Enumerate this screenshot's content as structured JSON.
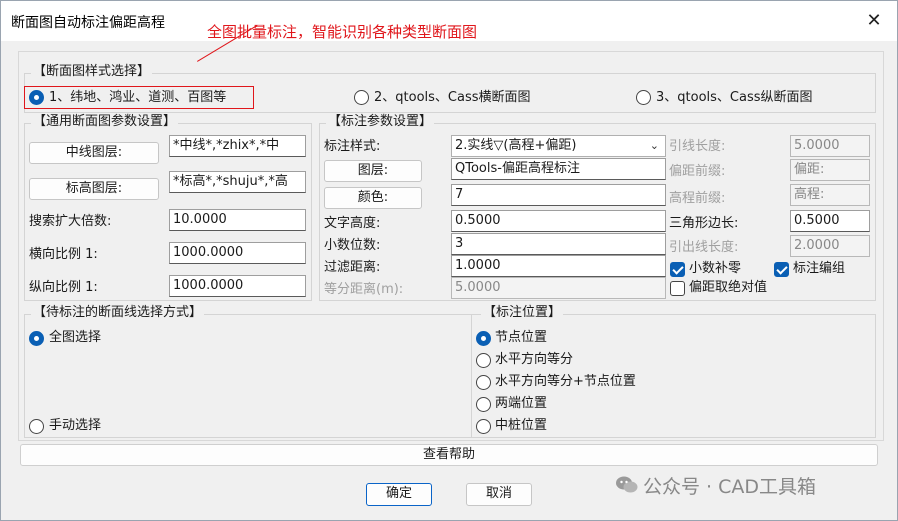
{
  "window": {
    "title": "断面图自动标注偏距高程",
    "close_glyph": "✕"
  },
  "annotation": {
    "text": "全图批量标注，智能识别各种类型断面图",
    "color": "#e0161b"
  },
  "style_group": {
    "legend": "【断面图样式选择】",
    "options": [
      {
        "label": "1、纬地、鸿业、道测、百图等",
        "selected": true
      },
      {
        "label": "2、qtools、Cass横断面图",
        "selected": false
      },
      {
        "label": "3、qtools、Cass纵断面图",
        "selected": false
      }
    ]
  },
  "general_group": {
    "legend": "【通用断面图参数设置】",
    "centerline_button": "中线图层:",
    "centerline_value": "*中线*,*zhix*,*中",
    "elev_button": "标高图层:",
    "elev_value": "*标高*,*shuju*,*高",
    "search_label": "搜索扩大倍数:",
    "search_value": "10.0000",
    "hscale_label": "横向比例 1:",
    "hscale_value": "1000.0000",
    "vscale_label": "纵向比例 1:",
    "vscale_value": "1000.0000"
  },
  "annot_group": {
    "legend": "【标注参数设置】",
    "style_label": "标注样式:",
    "style_value": "2.实线▽(高程+偏距)",
    "layer_button": "图层:",
    "layer_value": "QTools-偏距高程标注",
    "color_button": "颜色:",
    "color_value": "7",
    "text_height_label": "文字高度:",
    "text_height_value": "0.5000",
    "decimal_label": "小数位数:",
    "decimal_value": "3",
    "filter_label": "过滤距离:",
    "filter_value": "1.0000",
    "equal_label": "等分距离(m):",
    "equal_value": "5.0000",
    "leader_label": "引线长度:",
    "leader_value": "5.0000",
    "offset_prefix_label": "偏距前缀:",
    "offset_prefix_value": "偏距:",
    "elev_prefix_label": "高程前缀:",
    "elev_prefix_value": "高程:",
    "triangle_label": "三角形边长:",
    "triangle_value": "0.5000",
    "leadout_label": "引出线长度:",
    "leadout_value": "2.0000",
    "cb_decimal_pad": "小数补零",
    "cb_group": "标注编组",
    "cb_abs": "偏距取绝对值"
  },
  "pick_group": {
    "legend": "【待标注的断面线选择方式】",
    "whole": "全图选择",
    "manual": "手动选择"
  },
  "position_group": {
    "legend": "【标注位置】",
    "options": [
      {
        "label": "节点位置",
        "selected": true
      },
      {
        "label": "水平方向等分",
        "selected": false
      },
      {
        "label": "水平方向等分+节点位置",
        "selected": false
      },
      {
        "label": "两端位置",
        "selected": false
      },
      {
        "label": "中桩位置",
        "selected": false
      }
    ]
  },
  "footer": {
    "help": "查看帮助",
    "ok": "确定",
    "cancel": "取消"
  },
  "watermark": {
    "text": "公众号 · CAD工具箱"
  }
}
